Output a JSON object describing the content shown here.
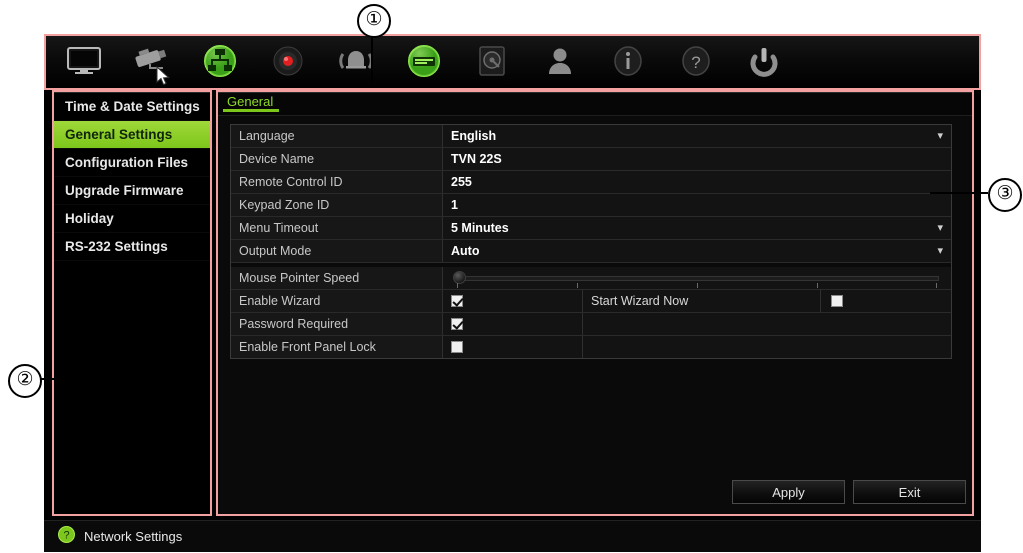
{
  "callouts": [
    {
      "label": "①",
      "target": "toolbar"
    },
    {
      "label": "②",
      "target": "sidebar"
    },
    {
      "label": "③",
      "target": "main-panel"
    }
  ],
  "toolbar": {
    "items": [
      {
        "name": "display-icon",
        "tooltip": "Display",
        "active": false
      },
      {
        "name": "camera-icon",
        "tooltip": "Camera",
        "active": false
      },
      {
        "name": "network-icon",
        "tooltip": "Network",
        "active": true
      },
      {
        "name": "record-icon",
        "tooltip": "Record",
        "active": false
      },
      {
        "name": "alarm-icon",
        "tooltip": "Alarm",
        "active": false
      },
      {
        "name": "device-settings-icon",
        "tooltip": "Device Settings",
        "active": true
      },
      {
        "name": "hdd-icon",
        "tooltip": "Storage",
        "active": false
      },
      {
        "name": "user-icon",
        "tooltip": "User Management",
        "active": false
      },
      {
        "name": "info-icon",
        "tooltip": "System Information",
        "active": false
      },
      {
        "name": "help-icon",
        "tooltip": "Help",
        "active": false
      },
      {
        "name": "power-icon",
        "tooltip": "Shutdown",
        "active": false
      }
    ]
  },
  "sidebar": {
    "items": [
      {
        "label": "Time & Date Settings",
        "active": false
      },
      {
        "label": "General Settings",
        "active": true
      },
      {
        "label": "Configuration Files",
        "active": false
      },
      {
        "label": "Upgrade Firmware",
        "active": false
      },
      {
        "label": "Holiday",
        "active": false
      },
      {
        "label": "RS-232 Settings",
        "active": false
      }
    ]
  },
  "panel": {
    "tab": "General",
    "rows": [
      {
        "type": "select",
        "label": "Language",
        "value": "English"
      },
      {
        "type": "text",
        "label": "Device Name",
        "value": "TVN 22S"
      },
      {
        "type": "text",
        "label": "Remote Control ID",
        "value": "255"
      },
      {
        "type": "text",
        "label": "Keypad Zone ID",
        "value": "1"
      },
      {
        "type": "select",
        "label": "Menu Timeout",
        "value": "5 Minutes"
      },
      {
        "type": "select",
        "label": "Output Mode",
        "value": "Auto"
      },
      {
        "type": "slider",
        "label": "Mouse Pointer Speed",
        "value": 0
      },
      {
        "type": "checkbox-wizard",
        "label": "Enable Wizard",
        "checked": true,
        "action_label": "Start Wizard Now",
        "action_checked": false
      },
      {
        "type": "checkbox",
        "label": "Password Required",
        "checked": true
      },
      {
        "type": "checkbox",
        "label": "Enable Front Panel Lock",
        "checked": false
      }
    ],
    "apply_label": "Apply",
    "exit_label": "Exit"
  },
  "statusbar": {
    "icon": "help-circle-icon",
    "text": "Network Settings"
  },
  "colors": {
    "accent_green": "#7dc61b",
    "tab_green": "#8ddc2a",
    "annotation_pink": "#f2a0a0",
    "panel_bg": "#0a0a0a"
  }
}
